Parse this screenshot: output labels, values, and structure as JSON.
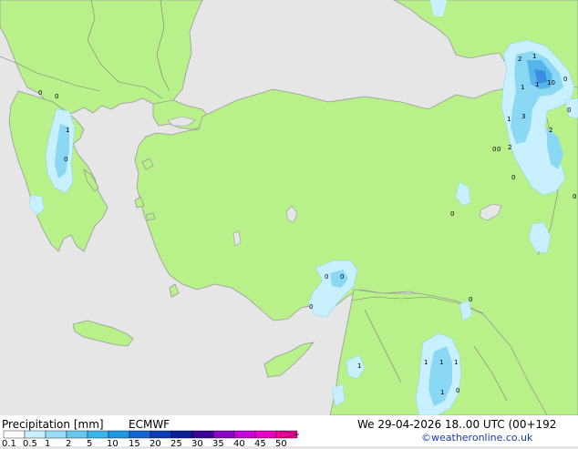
{
  "map": {
    "region": "Eastern Mediterranean / Greece / Turkey",
    "colors": {
      "sea": "#e6e6e6",
      "land": "#b8f08a",
      "coast": "#9a9a9a",
      "border": "#7e7e7e",
      "precip_light": "#c8f0ff",
      "precip_mid": "#8ad8f4",
      "precip_heavy": "#56b6ec",
      "precip_max": "#3c8ee0"
    },
    "point_labels": [
      "0",
      "0",
      "1",
      "0",
      "0",
      "0",
      "0",
      "0",
      "0",
      "2",
      "1",
      "1",
      "1",
      "10",
      "0",
      "1",
      "3",
      "2",
      "0",
      "2",
      "0",
      "0",
      "1",
      "1",
      "1",
      "1",
      "0",
      "1",
      "0",
      "0"
    ]
  },
  "footer": {
    "title": "Precipitation [mm]",
    "model": "ECMWF",
    "datetime": "We 29-04-2026 18..00 UTC (00+192",
    "credit": "©weatheronline.co.uk",
    "legend": {
      "ticks": [
        "0.1",
        "0.5",
        "1",
        "2",
        "5",
        "10",
        "15",
        "20",
        "25",
        "30",
        "35",
        "40",
        "45",
        "50"
      ],
      "colors": [
        "#ffffff",
        "#c8f0ff",
        "#96dcf8",
        "#64c8f0",
        "#3cb4ec",
        "#1e96e6",
        "#1464d2",
        "#0a3cb4",
        "#0a1e96",
        "#3c0096",
        "#8c00c8",
        "#c800dc",
        "#e600c8",
        "#f0009a"
      ]
    }
  }
}
